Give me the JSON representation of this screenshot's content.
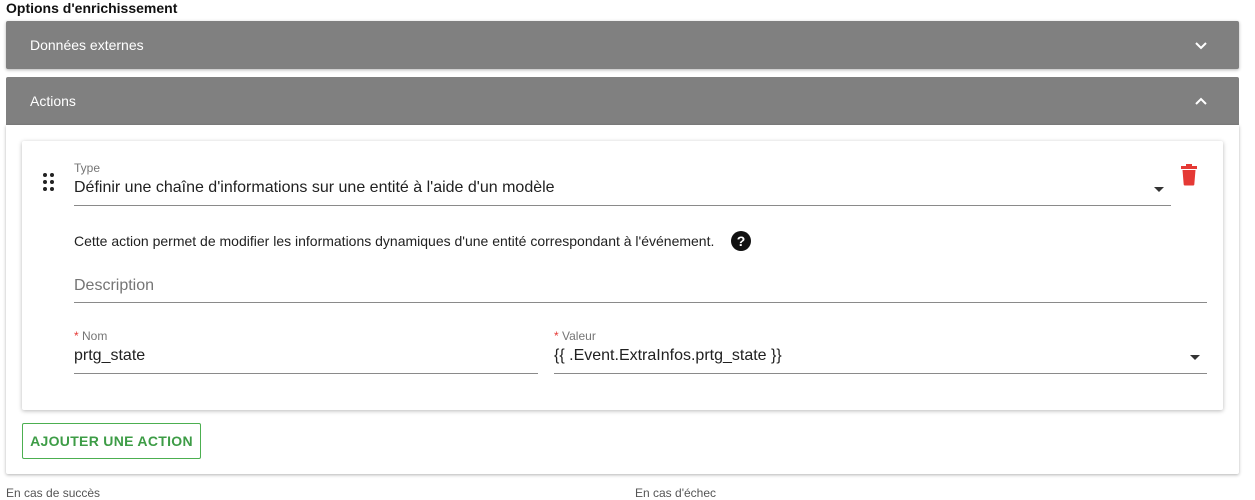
{
  "section_title": "Options d'enrichissement",
  "panels": {
    "external": {
      "label": "Données externes",
      "icon": "chevron-down-icon"
    },
    "actions": {
      "label": "Actions",
      "icon": "chevron-up-icon"
    }
  },
  "action": {
    "type_label": "Type",
    "type_value": "Définir une chaîne d'informations sur une entité à l'aide d'un modèle",
    "description_text": "Cette action permet de modifier les informations dynamiques d'une entité correspondant à l'événement.",
    "description_placeholder": "Description",
    "name_label": "Nom",
    "name_value": "prtg_state",
    "value_label": "Valeur",
    "value_value": "{{ .Event.ExtraInfos.prtg_state }}",
    "required_mark": "*"
  },
  "add_action_label": "Ajouter une action",
  "footer": {
    "success_label": "En cas de succès",
    "failure_label": "En cas d'échec"
  },
  "colors": {
    "panel_header": "#808080",
    "accent_green": "#4caf50",
    "delete_red": "#e53935"
  }
}
